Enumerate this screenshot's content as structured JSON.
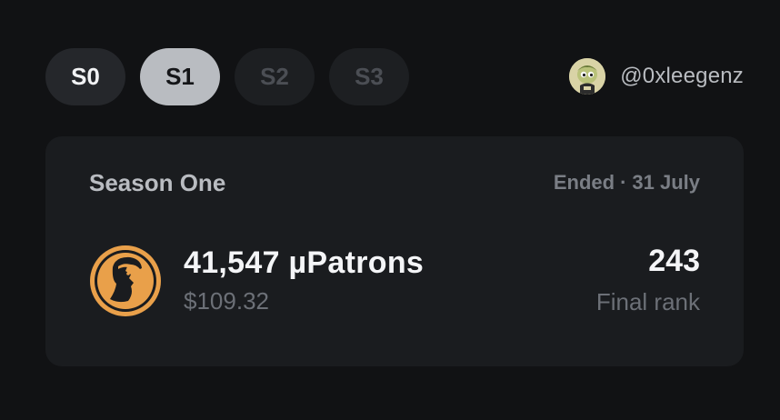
{
  "seasons": [
    {
      "label": "S0",
      "state": "inactive"
    },
    {
      "label": "S1",
      "state": "selected"
    },
    {
      "label": "S2",
      "state": "disabled"
    },
    {
      "label": "S3",
      "state": "disabled"
    }
  ],
  "user": {
    "handle": "@0xleegenz",
    "avatar_icon": "cartoon-avatar-icon"
  },
  "season_card": {
    "title": "Season One",
    "status": "Ended",
    "separator": "·",
    "date": "31 July",
    "token_icon": "patron-logo-icon",
    "amount": "41,547 µPatrons",
    "usd_value": "$109.32",
    "rank": "243",
    "rank_label": "Final rank"
  },
  "colors": {
    "background": "#111214",
    "card": "#1a1c1f",
    "accent_orange": "#e9a04a",
    "selected_tab": "#b9bcc1"
  }
}
